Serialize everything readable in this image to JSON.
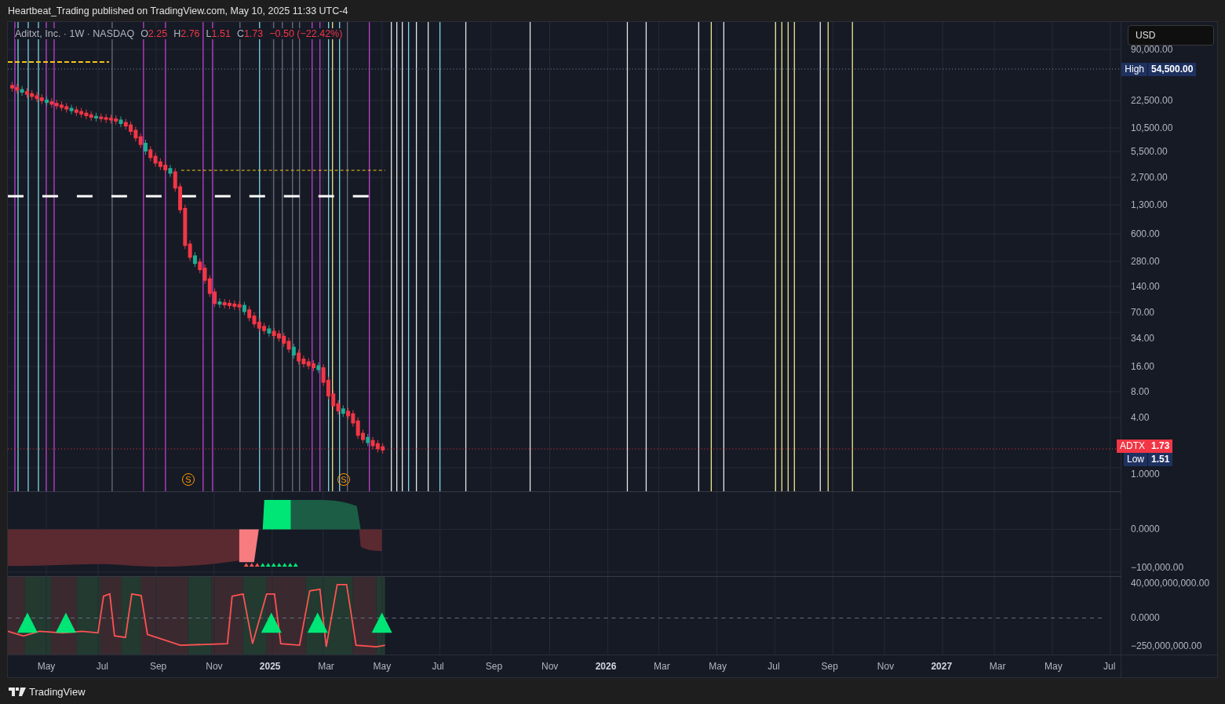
{
  "header": {
    "text": "Heartbeat_Trading published on TradingView.com, May 10, 2025 11:33 UTC-4"
  },
  "legend": {
    "symbol": "Aditxt, Inc. · 1W · NASDAQ",
    "values": [
      {
        "label": "O",
        "value": "2.25"
      },
      {
        "label": "H",
        "value": "2.76"
      },
      {
        "label": "L",
        "value": "1.51"
      },
      {
        "label": "C",
        "value": "1.73"
      }
    ],
    "change": "−0.50 (−22.42%)"
  },
  "currency_button": {
    "label": "USD"
  },
  "price_axis": {
    "labels": [
      "90,000.00",
      "22,500.00",
      "10,500.00",
      "5,500.00",
      "2,700.00",
      "1,300.00",
      "600.00",
      "280.00",
      "140.00",
      "70.00",
      "34.00",
      "16.00",
      "8.00",
      "4.00",
      "1.0000"
    ]
  },
  "price_tags": [
    {
      "kind": "high",
      "label": "High",
      "value": "54,500.00"
    },
    {
      "kind": "last",
      "label": "ADTX",
      "value": "1.73"
    },
    {
      "kind": "low",
      "label": "Low",
      "value": "1.51"
    }
  ],
  "event_markers": [
    {
      "label": "S"
    },
    {
      "label": "S"
    }
  ],
  "indicator_1": {
    "axis_labels": [
      "0.0000",
      "−100,000.00"
    ]
  },
  "indicator_2": {
    "axis_labels": [
      "40,000,000,000.00",
      "0.0000",
      "−250,000,000.00"
    ]
  },
  "time_axis": {
    "labels": [
      {
        "text": "May",
        "year": false
      },
      {
        "text": "Jul",
        "year": false
      },
      {
        "text": "Sep",
        "year": false
      },
      {
        "text": "Nov",
        "year": false
      },
      {
        "text": "2025",
        "year": true
      },
      {
        "text": "Mar",
        "year": false
      },
      {
        "text": "May",
        "year": false
      },
      {
        "text": "Jul",
        "year": false
      },
      {
        "text": "Sep",
        "year": false
      },
      {
        "text": "Nov",
        "year": false
      },
      {
        "text": "2026",
        "year": true
      },
      {
        "text": "Mar",
        "year": false
      },
      {
        "text": "May",
        "year": false
      },
      {
        "text": "Jul",
        "year": false
      },
      {
        "text": "Sep",
        "year": false
      },
      {
        "text": "Nov",
        "year": false
      },
      {
        "text": "2027",
        "year": true
      },
      {
        "text": "Mar",
        "year": false
      },
      {
        "text": "May",
        "year": false
      },
      {
        "text": "Jul",
        "year": false
      }
    ]
  },
  "footer": {
    "brand": "TradingView"
  }
}
